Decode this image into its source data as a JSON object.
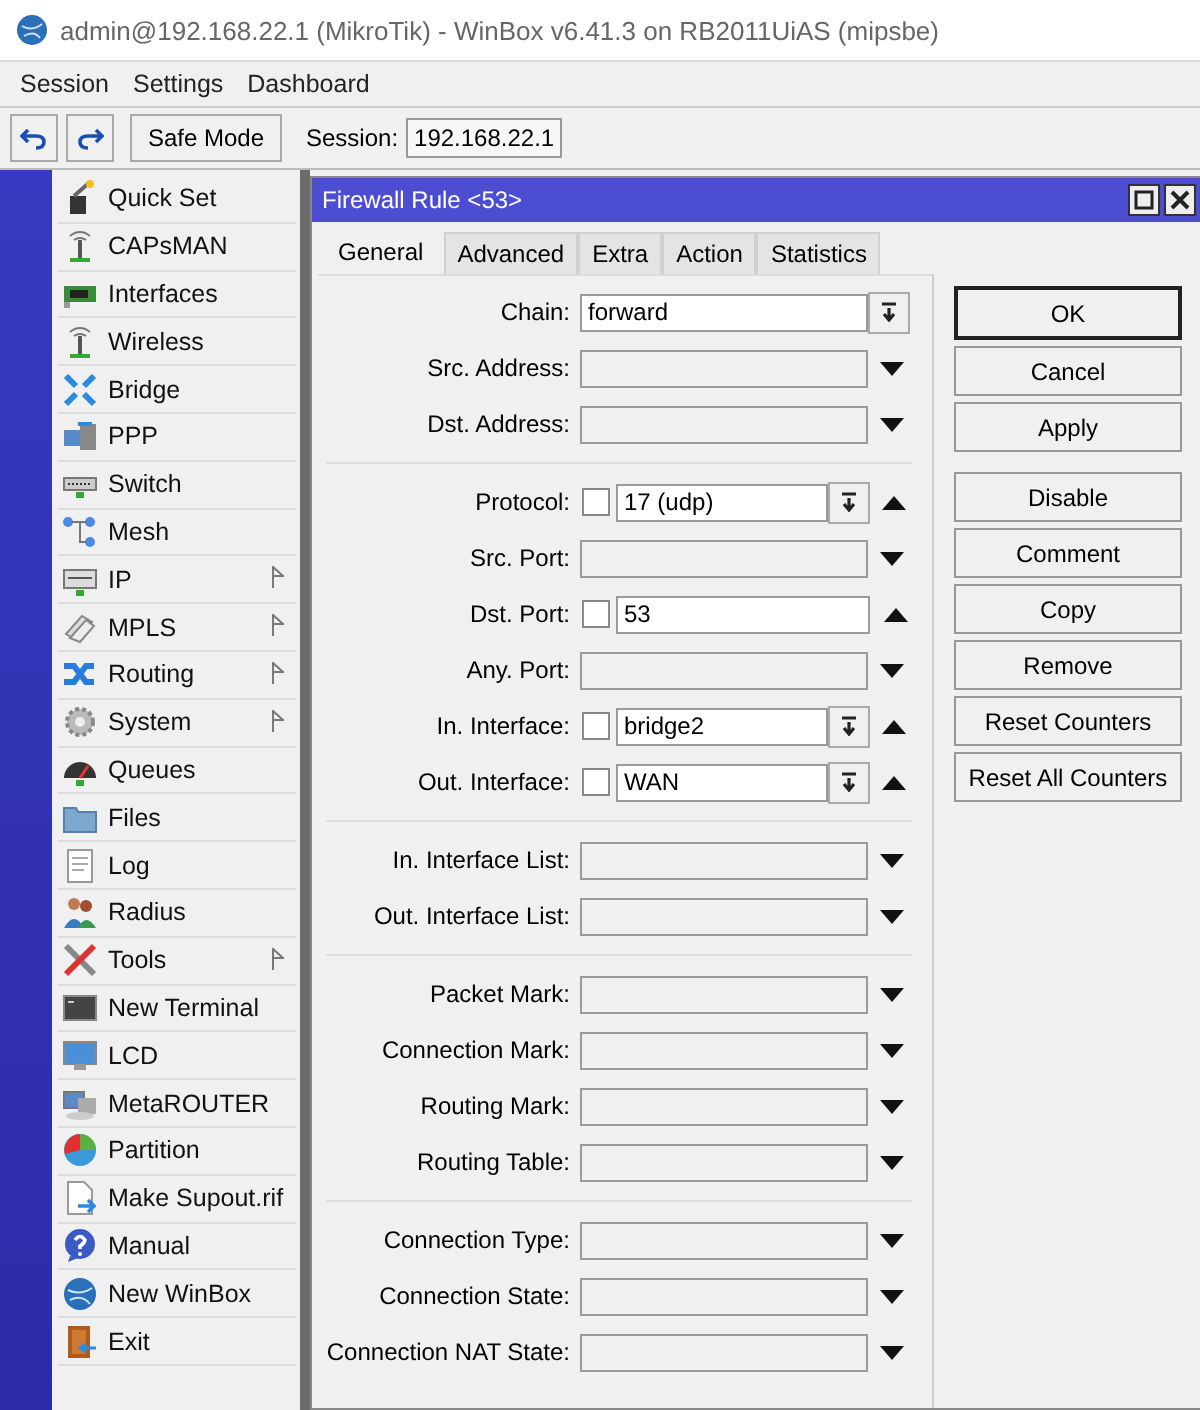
{
  "window": {
    "title": "admin@192.168.22.1 (MikroTik) - WinBox v6.41.3 on RB2011UiAS (mipsbe)"
  },
  "menu": [
    "Session",
    "Settings",
    "Dashboard"
  ],
  "toolbar": {
    "safe_mode": "Safe Mode",
    "session_label": "Session:",
    "session_value": "192.168.22.1"
  },
  "sidebar": {
    "items": [
      {
        "label": "Quick Set",
        "submenu": false
      },
      {
        "label": "CAPsMAN",
        "submenu": false
      },
      {
        "label": "Interfaces",
        "submenu": false
      },
      {
        "label": "Wireless",
        "submenu": false
      },
      {
        "label": "Bridge",
        "submenu": false
      },
      {
        "label": "PPP",
        "submenu": false
      },
      {
        "label": "Switch",
        "submenu": false
      },
      {
        "label": "Mesh",
        "submenu": false
      },
      {
        "label": "IP",
        "submenu": true
      },
      {
        "label": "MPLS",
        "submenu": true
      },
      {
        "label": "Routing",
        "submenu": true
      },
      {
        "label": "System",
        "submenu": true
      },
      {
        "label": "Queues",
        "submenu": false
      },
      {
        "label": "Files",
        "submenu": false
      },
      {
        "label": "Log",
        "submenu": false
      },
      {
        "label": "Radius",
        "submenu": false
      },
      {
        "label": "Tools",
        "submenu": true
      },
      {
        "label": "New Terminal",
        "submenu": false
      },
      {
        "label": "LCD",
        "submenu": false
      },
      {
        "label": "MetaROUTER",
        "submenu": false
      },
      {
        "label": "Partition",
        "submenu": false
      },
      {
        "label": "Make Supout.rif",
        "submenu": false
      },
      {
        "label": "Manual",
        "submenu": false
      },
      {
        "label": "New WinBox",
        "submenu": false
      },
      {
        "label": "Exit",
        "submenu": false
      }
    ]
  },
  "dialog": {
    "title": "Firewall Rule <53>",
    "tabs": [
      {
        "label": "General",
        "selected": true
      },
      {
        "label": "Advanced",
        "selected": false
      },
      {
        "label": "Extra",
        "selected": false
      },
      {
        "label": "Action",
        "selected": false
      },
      {
        "label": "Statistics",
        "selected": false
      }
    ],
    "sections": [
      [
        {
          "kind": "combo",
          "label": "Chain:",
          "value": "forward"
        },
        {
          "kind": "filter",
          "label": "Src. Address:",
          "expanded": false
        },
        {
          "kind": "filter",
          "label": "Dst. Address:",
          "expanded": false
        }
      ],
      [
        {
          "kind": "filter",
          "label": "Protocol:",
          "expanded": true,
          "negated": false,
          "value": "17 (udp)",
          "dropdown": true
        },
        {
          "kind": "filter",
          "label": "Src. Port:",
          "expanded": false
        },
        {
          "kind": "filter",
          "label": "Dst. Port:",
          "expanded": true,
          "negated": false,
          "value": "53",
          "dropdown": false
        },
        {
          "kind": "filter",
          "label": "Any. Port:",
          "expanded": false
        },
        {
          "kind": "filter",
          "label": "In. Interface:",
          "expanded": true,
          "negated": false,
          "value": "bridge2",
          "dropdown": true
        },
        {
          "kind": "filter",
          "label": "Out. Interface:",
          "expanded": true,
          "negated": false,
          "value": "WAN",
          "dropdown": true
        }
      ],
      [
        {
          "kind": "filter",
          "label": "In. Interface List:",
          "expanded": false
        },
        {
          "kind": "filter",
          "label": "Out. Interface List:",
          "expanded": false
        }
      ],
      [
        {
          "kind": "filter",
          "label": "Packet Mark:",
          "expanded": false
        },
        {
          "kind": "filter",
          "label": "Connection Mark:",
          "expanded": false
        },
        {
          "kind": "filter",
          "label": "Routing Mark:",
          "expanded": false
        },
        {
          "kind": "filter",
          "label": "Routing Table:",
          "expanded": false
        }
      ],
      [
        {
          "kind": "filter",
          "label": "Connection Type:",
          "expanded": false
        },
        {
          "kind": "filter",
          "label": "Connection State:",
          "expanded": false
        },
        {
          "kind": "filter",
          "label": "Connection NAT State:",
          "expanded": false
        }
      ]
    ],
    "buttons": [
      [
        {
          "label": "OK",
          "default": true
        },
        {
          "label": "Cancel",
          "default": false
        },
        {
          "label": "Apply",
          "default": false
        }
      ],
      [
        {
          "label": "Disable",
          "default": false
        },
        {
          "label": "Comment",
          "default": false
        },
        {
          "label": "Copy",
          "default": false
        },
        {
          "label": "Remove",
          "default": false
        },
        {
          "label": "Reset Counters",
          "default": false
        },
        {
          "label": "Reset All Counters",
          "default": false
        }
      ]
    ]
  }
}
